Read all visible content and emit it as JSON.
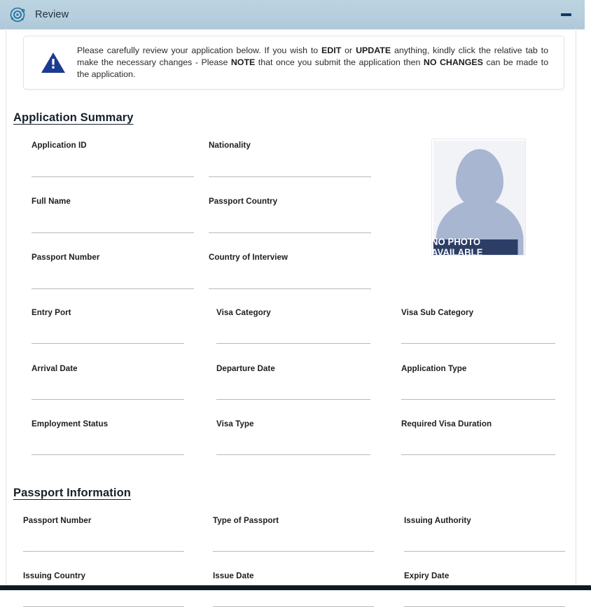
{
  "panel": {
    "title": "Review",
    "icon": "orbit-target-icon",
    "collapse_label": "−",
    "header_bg": "#b6cedd"
  },
  "alert": {
    "icon": "warning-triangle-icon",
    "icon_color": "#1b3a91",
    "segments": [
      {
        "text": "Please carefully review your application below. If you wish to ",
        "bold": false
      },
      {
        "text": "EDIT",
        "bold": true
      },
      {
        "text": " or ",
        "bold": false
      },
      {
        "text": "UPDATE",
        "bold": true
      },
      {
        "text": " anything, kindly click the relative tab to make the necessary changes - Please ",
        "bold": false
      },
      {
        "text": "NOTE",
        "bold": true
      },
      {
        "text": " that once you submit the application then ",
        "bold": false
      },
      {
        "text": "NO CHANGES",
        "bold": true
      },
      {
        "text": " can be made to the application.",
        "bold": false
      }
    ]
  },
  "sections": [
    {
      "id": "application-summary",
      "title": "Application Summary"
    },
    {
      "id": "passport-information",
      "title": "Passport Information"
    }
  ],
  "photo": {
    "caption": "NO PHOTO AVAILABLE",
    "alt_name": "applicant-photo-placeholder",
    "bg_color": "#f2f3f7",
    "silhouette_color": "#a9b6d2",
    "caption_bg": "#2c3e66"
  },
  "summary_fields": [
    {
      "label": "Application ID",
      "value": ""
    },
    {
      "label": "Nationality",
      "value": ""
    },
    {
      "label": "Full Name",
      "value": ""
    },
    {
      "label": "Passport Country",
      "value": ""
    },
    {
      "label": "Passport Number",
      "value": ""
    },
    {
      "label": "Country of Interview",
      "value": ""
    },
    {
      "label": "Entry Port",
      "value": ""
    },
    {
      "label": "Visa Category",
      "value": ""
    },
    {
      "label": "Visa Sub Category",
      "value": ""
    },
    {
      "label": "Arrival Date",
      "value": ""
    },
    {
      "label": "Departure Date",
      "value": ""
    },
    {
      "label": "Application Type",
      "value": ""
    },
    {
      "label": "Employment Status",
      "value": ""
    },
    {
      "label": "Visa Type",
      "value": ""
    },
    {
      "label": "Required Visa Duration",
      "value": ""
    }
  ],
  "passport_fields": [
    {
      "label": "Passport Number",
      "value": ""
    },
    {
      "label": "Type of Passport",
      "value": ""
    },
    {
      "label": "Issuing Authority",
      "value": ""
    },
    {
      "label": "Issuing Country",
      "value": ""
    },
    {
      "label": "Issue Date",
      "value": ""
    },
    {
      "label": "Expiry Date",
      "value": ""
    }
  ]
}
